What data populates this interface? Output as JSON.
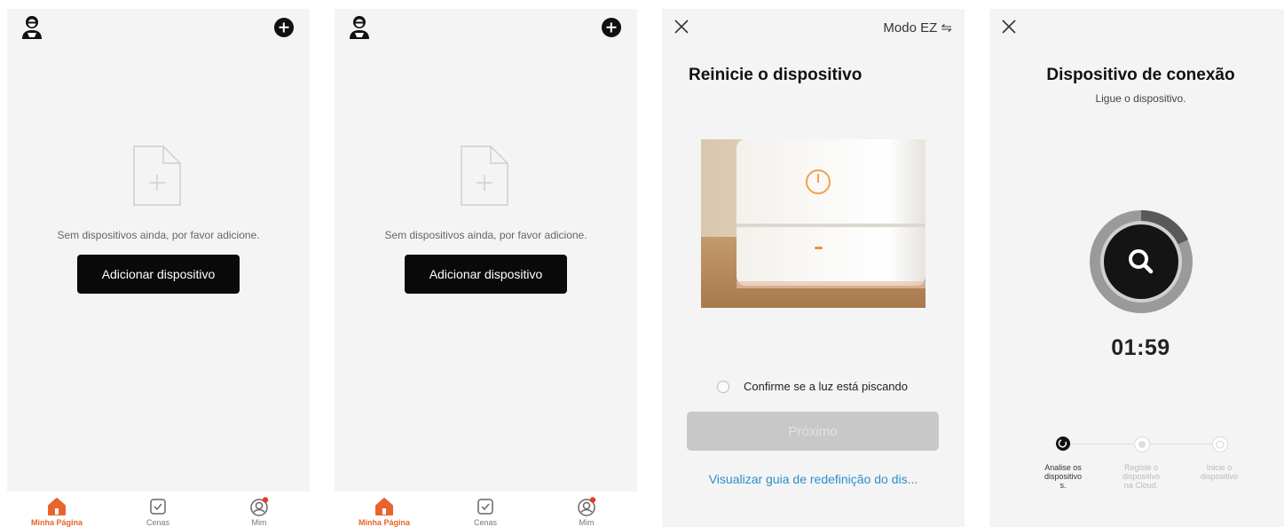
{
  "home_screens": [
    {
      "empty_text": "Sem dispositivos ainda, por favor adicione.",
      "add_button": "Adicionar dispositivo",
      "tabs": [
        "Minha Página",
        "Cenas",
        "Mim"
      ]
    },
    {
      "empty_text": "Sem dispositivos ainda, por favor adicione.",
      "add_button": "Adicionar dispositivo",
      "tabs": [
        "Minha Página",
        "Cenas",
        "Mim"
      ]
    }
  ],
  "reset_screen": {
    "mode_label": "Modo EZ ⇋",
    "title": "Reinicie o dispositivo",
    "confirm_text": "Confirme se a luz está piscando",
    "next_button": "Próximo",
    "guide_link": "Visualizar guia de redefinição do dis..."
  },
  "connect_screen": {
    "title": "Dispositivo de conexão",
    "subtitle": "Ligue o dispositivo.",
    "timer": "01:59",
    "steps": [
      {
        "lines": [
          "Analise os",
          "dispositivo",
          "s."
        ]
      },
      {
        "lines": [
          "Registe o",
          "dispositivo",
          "na Cloud."
        ]
      },
      {
        "lines": [
          "Inicie o",
          "dispositivo"
        ]
      }
    ]
  },
  "colors": {
    "accent": "#e8642c",
    "link": "#2a8fd0",
    "disabled_button": "#c8c8c8",
    "background": "#f4f4f4"
  },
  "icons": [
    "avatar-icon",
    "add-circle-icon",
    "empty-document-icon",
    "home-icon",
    "scenes-check-icon",
    "profile-icon",
    "close-icon",
    "search-icon"
  ]
}
